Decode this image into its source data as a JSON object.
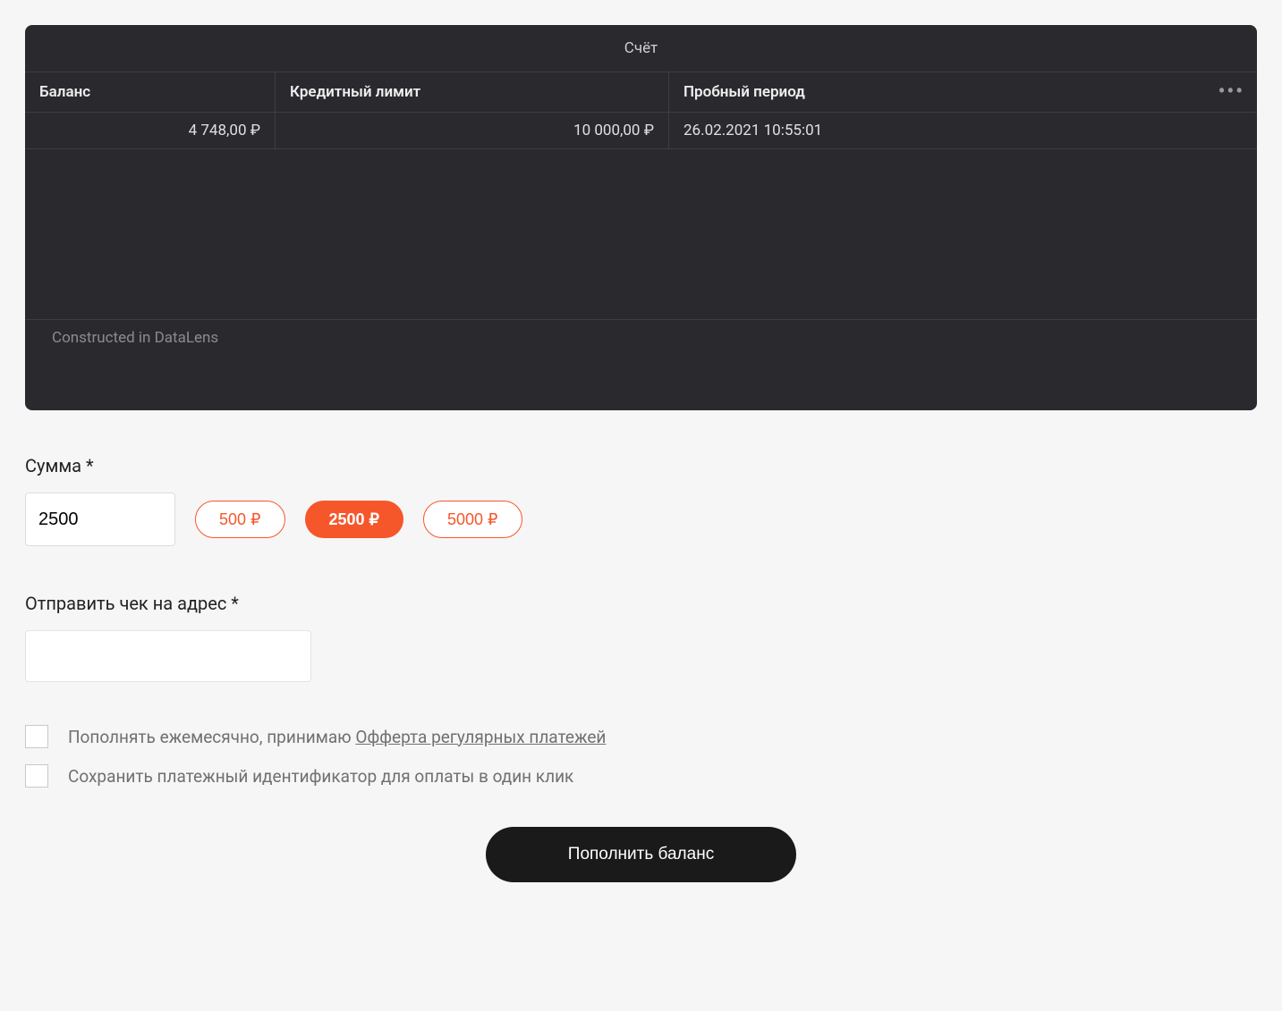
{
  "panel": {
    "title": "Счёт",
    "columns": {
      "balance": "Баланс",
      "credit": "Кредитный лимит",
      "trial": "Пробный период"
    },
    "row": {
      "balance": "4 748,00 ₽",
      "credit": "10 000,00 ₽",
      "trial": "26.02.2021 10:55:01"
    },
    "footer": "Constructed in DataLens"
  },
  "amount": {
    "label": "Сумма *",
    "value": "2500",
    "presets": [
      "500 ₽",
      "2500 ₽",
      "5000 ₽"
    ],
    "active_index": 1
  },
  "email": {
    "label": "Отправить чек на адрес *",
    "value": ""
  },
  "checks": {
    "monthly_prefix": "Пополнять ежемесячно, принимаю ",
    "monthly_link": "Офферта регулярных платежей",
    "save_id": "Сохранить платежный идентификатор для оплаты в один клик"
  },
  "submit_label": "Пополнить баланс"
}
